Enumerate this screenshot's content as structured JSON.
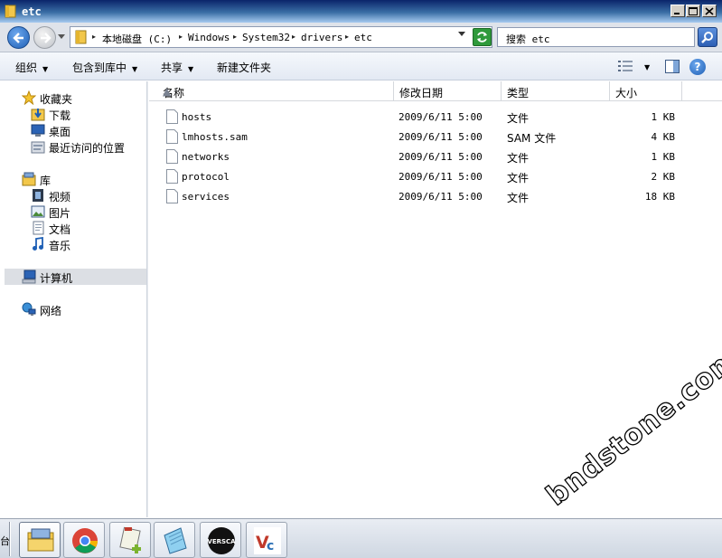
{
  "window": {
    "title": "etc"
  },
  "address": {
    "crumbs": [
      "本地磁盘 (C:)",
      "Windows",
      "System32",
      "drivers",
      "etc"
    ]
  },
  "search": {
    "placeholder": "搜索 etc"
  },
  "toolbar": {
    "organize": "组织",
    "include_library": "包含到库中",
    "share": "共享",
    "new_folder": "新建文件夹"
  },
  "sidebar": {
    "favorites": {
      "label": "收藏夹",
      "items": [
        "下载",
        "桌面",
        "最近访问的位置"
      ]
    },
    "libraries": {
      "label": "库",
      "items": [
        "视频",
        "图片",
        "文档",
        "音乐"
      ]
    },
    "computer": {
      "label": "计算机"
    },
    "network": {
      "label": "网络"
    }
  },
  "columns": {
    "name": "名称",
    "modified": "修改日期",
    "type": "类型",
    "size": "大小"
  },
  "files": [
    {
      "name": "hosts",
      "modified": "2009/6/11 5:00",
      "type": "文件",
      "size": "1 KB"
    },
    {
      "name": "lmhosts.sam",
      "modified": "2009/6/11 5:00",
      "type": "SAM 文件",
      "size": "4 KB"
    },
    {
      "name": "networks",
      "modified": "2009/6/11 5:00",
      "type": "文件",
      "size": "1 KB"
    },
    {
      "name": "protocol",
      "modified": "2009/6/11 5:00",
      "type": "文件",
      "size": "2 KB"
    },
    {
      "name": "services",
      "modified": "2009/6/11 5:00",
      "type": "文件",
      "size": "18 KB"
    }
  ],
  "watermark": "bndstone.com",
  "taskbar": {
    "edge_text": "台"
  },
  "taskbar_icons": [
    "explorer-icon",
    "chrome-icon",
    "notepad-plus-icon",
    "notepad-icon",
    "versa-icon",
    "vnc-icon"
  ],
  "colors": {
    "title_bar": "#0a246a",
    "accent": "#1e5fb5",
    "selected_row": "#dcdfe4"
  }
}
